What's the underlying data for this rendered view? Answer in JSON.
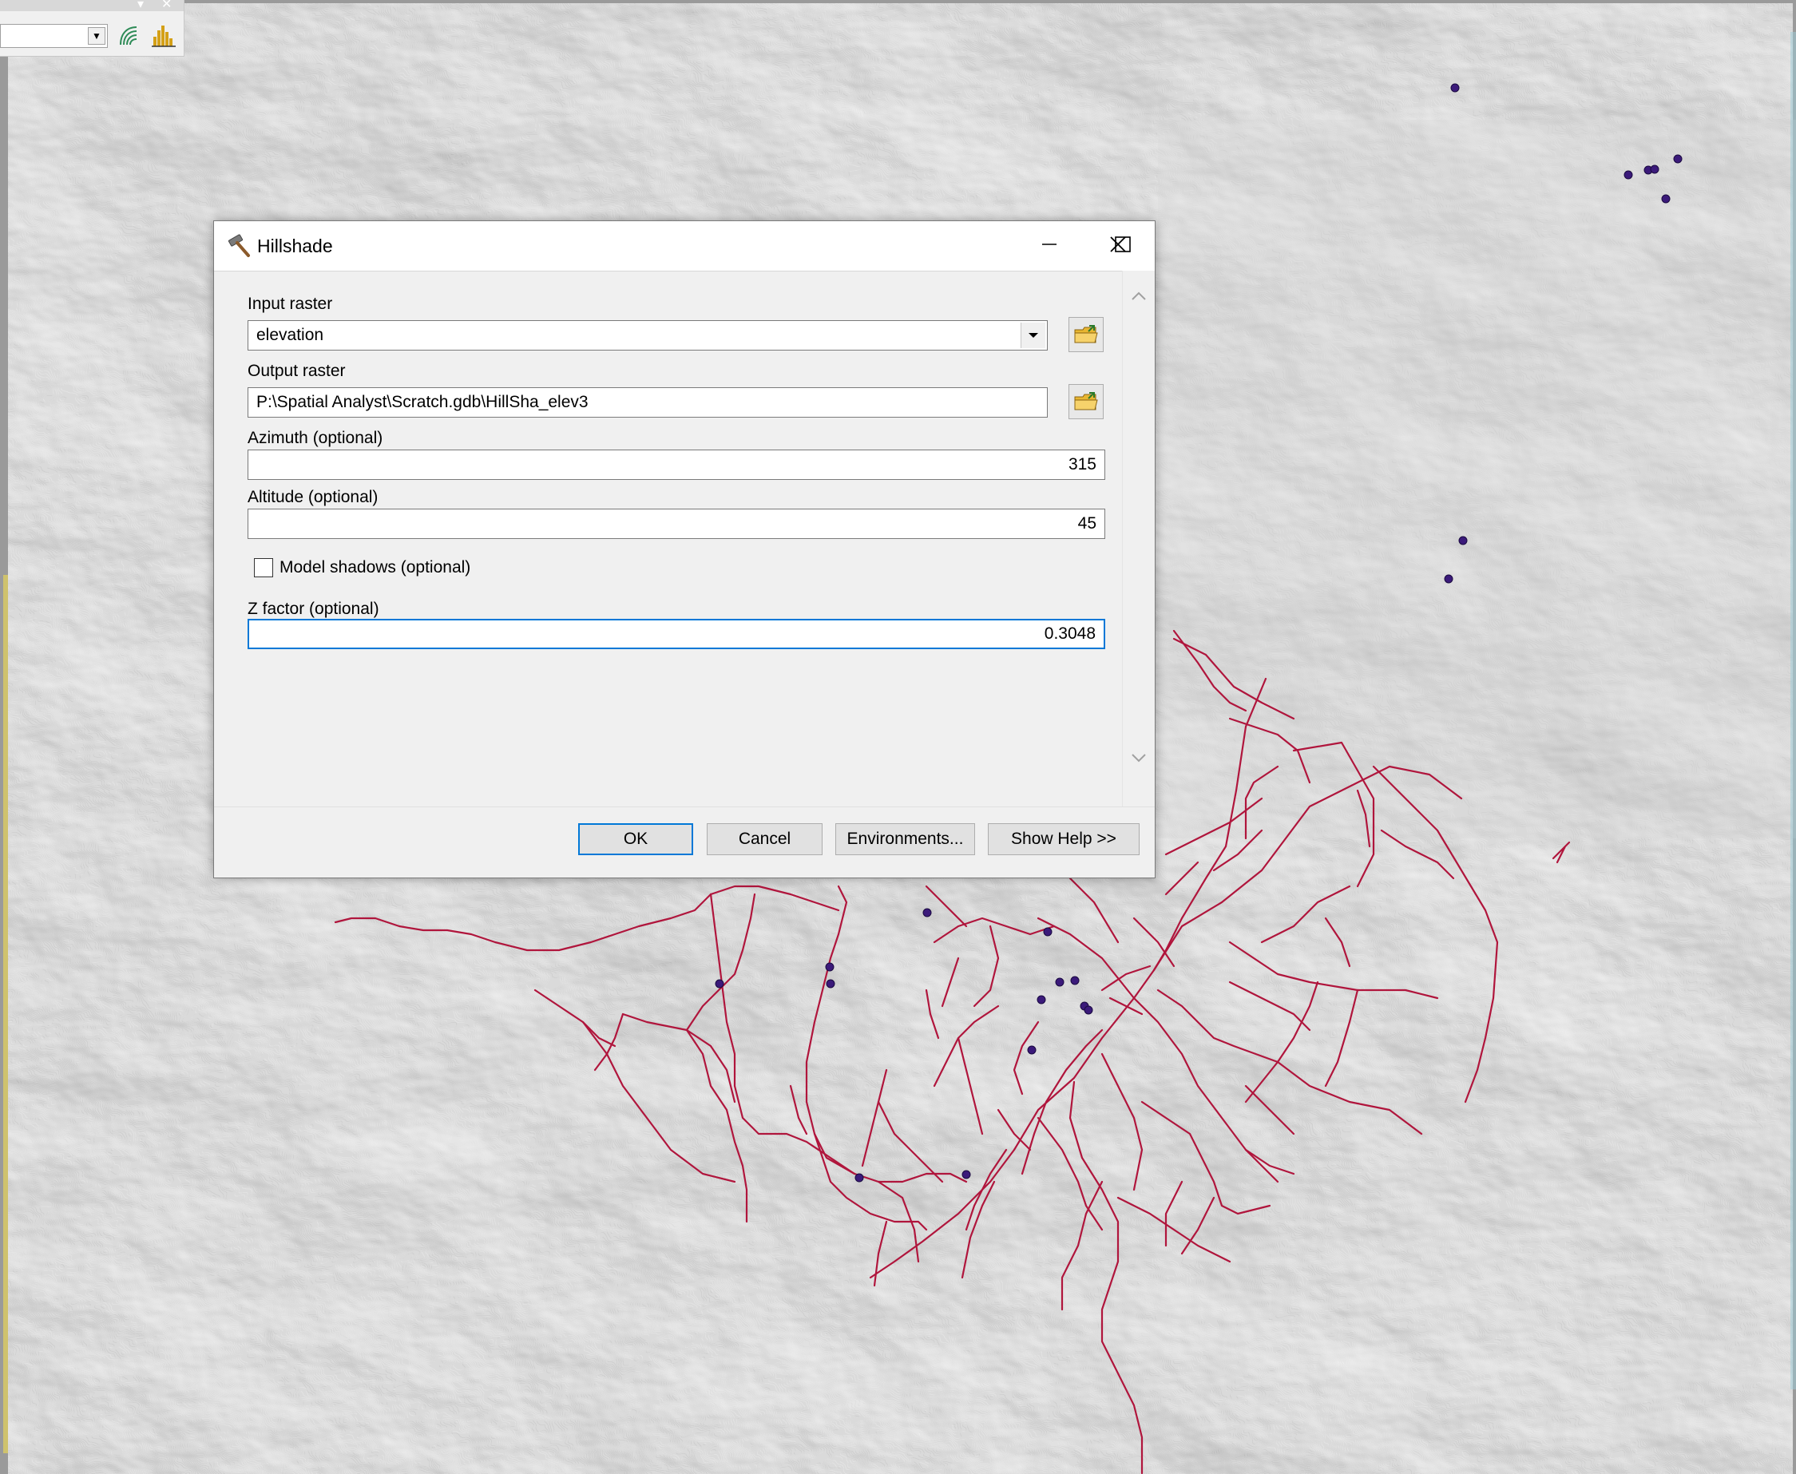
{
  "dialog": {
    "title": "Hillshade",
    "title_icon": "hammer-icon",
    "fields": {
      "input_raster": {
        "label": "Input raster",
        "value": "elevation"
      },
      "output_raster": {
        "label": "Output raster",
        "value": "P:\\Spatial Analyst\\Scratch.gdb\\HillSha_elev3"
      },
      "azimuth": {
        "label": "Azimuth (optional)",
        "value": "315"
      },
      "altitude": {
        "label": "Altitude (optional)",
        "value": "45"
      },
      "model_shadows": {
        "label": "Model shadows (optional)",
        "checked": false
      },
      "z_factor": {
        "label": "Z factor (optional)",
        "value": "0.3048"
      }
    },
    "buttons": {
      "ok": "OK",
      "cancel": "Cancel",
      "environments": "Environments...",
      "show_help": "Show Help >>"
    }
  },
  "map": {
    "layers": [
      "hillshade-raster",
      "roads-lines",
      "point-features"
    ],
    "colors": {
      "roads": "#b0153c",
      "points": "#3b1a7a",
      "accent": "#0078d7"
    }
  },
  "toolbar": {
    "icons": [
      "contour-icon",
      "histogram-icon"
    ]
  }
}
